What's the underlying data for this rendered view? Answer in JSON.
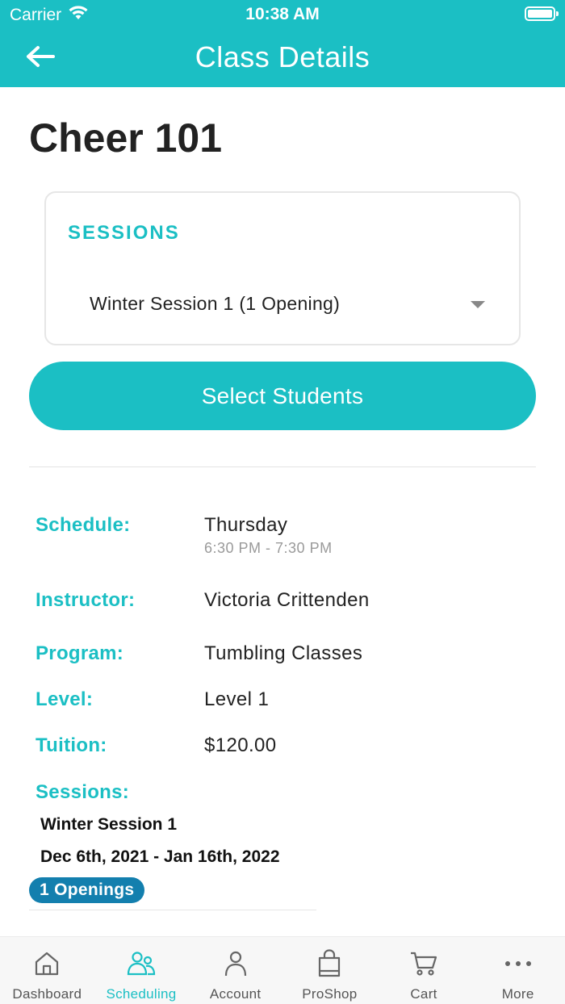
{
  "status_bar": {
    "carrier": "Carrier",
    "time": "10:38 AM"
  },
  "nav": {
    "title": "Class Details",
    "back_icon": "arrow-left-icon"
  },
  "class": {
    "title": "Cheer 101"
  },
  "sessions_card": {
    "label": "SESSIONS",
    "selected_value": "Winter Session 1 (1 Opening)"
  },
  "select_students_label": "Select Students",
  "details": {
    "schedule_label": "Schedule:",
    "schedule_day": "Thursday",
    "schedule_time": "6:30 PM - 7:30 PM",
    "instructor_label": "Instructor:",
    "instructor_value": "Victoria Crittenden",
    "program_label": "Program:",
    "program_value": "Tumbling Classes",
    "level_label": "Level:",
    "level_value": "Level 1",
    "tuition_label": "Tuition:",
    "tuition_value": "$120.00",
    "sessions_label": "Sessions:"
  },
  "session_entry": {
    "name": "Winter Session 1",
    "dates": "Dec 6th, 2021 - Jan 16th, 2022",
    "openings": "1 Openings"
  },
  "tabs": [
    {
      "label": "Dashboard",
      "icon": "home-icon",
      "active": false
    },
    {
      "label": "Scheduling",
      "icon": "people-icon",
      "active": true
    },
    {
      "label": "Account",
      "icon": "person-icon",
      "active": false
    },
    {
      "label": "ProShop",
      "icon": "shopping-bag-icon",
      "active": false
    },
    {
      "label": "Cart",
      "icon": "cart-icon",
      "active": false
    },
    {
      "label": "More",
      "icon": "more-dots-icon",
      "active": false
    }
  ],
  "colors": {
    "accent": "#1bbfc4",
    "badge": "#137fae",
    "tab_inactive": "#555555"
  }
}
